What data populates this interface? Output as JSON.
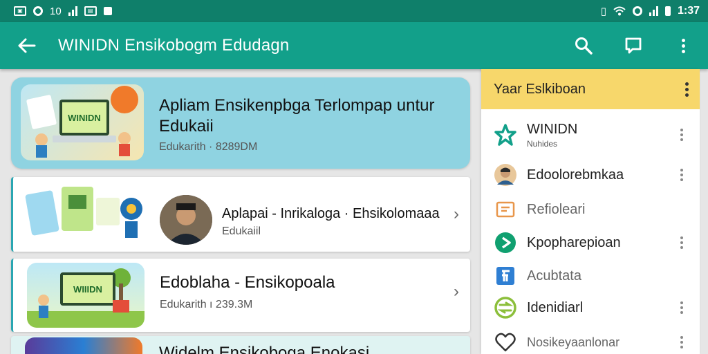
{
  "status_bar": {
    "left_icons": [
      "photo-icon",
      "sync-icon",
      "signal-icon",
      "image-icon",
      "notification-icon"
    ],
    "left_text": "10",
    "right_icons": [
      "vibrate-icon",
      "wifi-icon",
      "alarm-icon",
      "signal-icon",
      "battery-icon"
    ],
    "time": "1:37"
  },
  "app_bar": {
    "title": "WINIDN Ensikobogm Edudagn",
    "actions": [
      "search-icon",
      "message-icon",
      "more-vert-icon"
    ]
  },
  "main": {
    "cards": [
      {
        "title": "Apliam Ensikenpbga Terlompap untur Edukaii",
        "subtitle": "Edukarith · 8289DM",
        "thumb_text": "WINIDN"
      },
      {
        "title": "Aplapai - Inrikaloga · Ehsikolomaaa",
        "subtitle": "Edukaiil"
      },
      {
        "title": "Edoblaha - Ensikopoala",
        "subtitle": "Edukarith ı 239.3M",
        "thumb_text": "WIIIDN"
      },
      {
        "title": "Widelm Ensikoboga Enokasi",
        "subtitle": ""
      }
    ]
  },
  "panel": {
    "header": "Yaar Eslkiboan",
    "items": [
      {
        "label": "WINIDN",
        "sub": "Nuhides",
        "icon": "star-icon",
        "color": "#12a08a",
        "has_menu": true
      },
      {
        "label": "Edoolorebmkaa",
        "icon": "avatar",
        "color": "#555555",
        "has_menu": true
      },
      {
        "label": "Refioleari",
        "icon": "document-icon",
        "color": "#e8964a",
        "has_menu": false
      },
      {
        "label": "Kpopharepioan",
        "icon": "play-icon",
        "color": "#10a070",
        "has_menu": true
      },
      {
        "label": "Acubtata",
        "icon": "flag-icon",
        "color": "#2f7fd3",
        "has_menu": false
      },
      {
        "label": "Idenidiarl",
        "icon": "globe-icon",
        "color": "#8cbf3b",
        "has_menu": true
      },
      {
        "label": "Nosikeyaanlonar",
        "icon": "heart-icon",
        "color": "#333333",
        "has_menu": true
      }
    ]
  },
  "colors": {
    "status": "#0f7f6a",
    "app_bar": "#12a08a",
    "panel_header": "#f7d76b",
    "featured_card": "#8fd3e1"
  }
}
